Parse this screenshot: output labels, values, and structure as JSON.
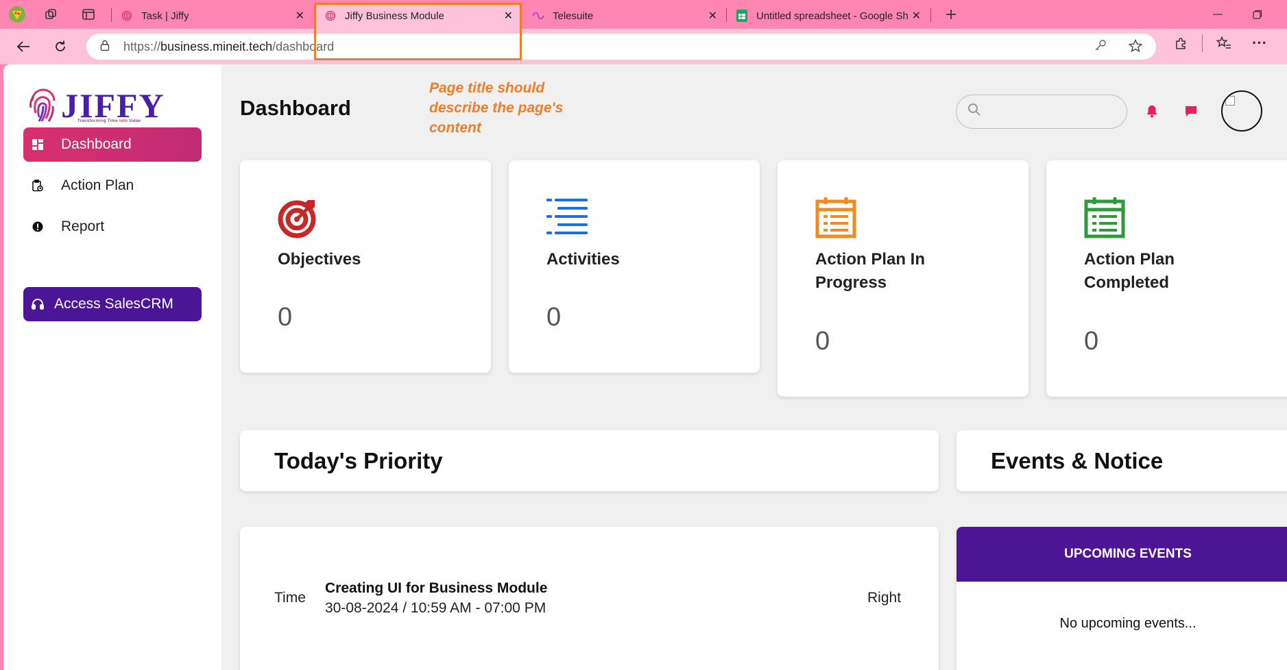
{
  "browser": {
    "tabs": [
      {
        "label": "Task | Jiffy",
        "favicon": "fingerprint-icon",
        "active": false
      },
      {
        "label": "Jiffy Business Module",
        "favicon": "fingerprint-icon",
        "active": true
      },
      {
        "label": "Telesuite",
        "favicon": "telesuite-icon",
        "active": false
      },
      {
        "label": "Untitled spreadsheet - Google Sh",
        "favicon": "sheets-icon",
        "active": false
      }
    ],
    "url": {
      "scheme": "https://",
      "host": "business.mineit.tech",
      "path": "/dashboard"
    }
  },
  "annotation": {
    "text": "Page title should describe the page's content",
    "color": "#f27d26"
  },
  "sidebar": {
    "logo_text": "JIFFY",
    "logo_tagline": "Transforming Time into Value",
    "items": [
      {
        "label": "Dashboard",
        "icon": "dashboard-icon",
        "active": true
      },
      {
        "label": "Action Plan",
        "icon": "clipboard-clock-icon",
        "active": false
      },
      {
        "label": "Report",
        "icon": "alert-circle-icon",
        "active": false
      }
    ],
    "crm_button": {
      "label": "Access SalesCRM",
      "icon": "headset-icon"
    }
  },
  "header": {
    "title": "Dashboard",
    "search_placeholder": ""
  },
  "cards": [
    {
      "label": "Objectives",
      "value": "0",
      "icon": "target-icon",
      "color": "#c62828"
    },
    {
      "label": "Activities",
      "value": "0",
      "icon": "list-icon",
      "color": "#1e6fd9"
    },
    {
      "label": "Action Plan In Progress",
      "value": "0",
      "icon": "calendar-list-icon",
      "color": "#f28a1e"
    },
    {
      "label": "Action Plan Completed",
      "value": "0",
      "icon": "calendar-list-icon",
      "color": "#2e9b3a"
    }
  ],
  "priority": {
    "title": "Today's Priority",
    "task": {
      "time_label": "Time",
      "title": "Creating UI for Business Module",
      "datetime": "30-08-2024 / 10:59 AM - 07:00 PM",
      "status": "Right"
    }
  },
  "events": {
    "title": "Events & Notice",
    "header": "UPCOMING EVENTS",
    "empty_text": "No upcoming events..."
  },
  "colors": {
    "brand_pink": "#d9306e",
    "brand_purple": "#4b1596",
    "browser_frame": "#ff86b3"
  }
}
